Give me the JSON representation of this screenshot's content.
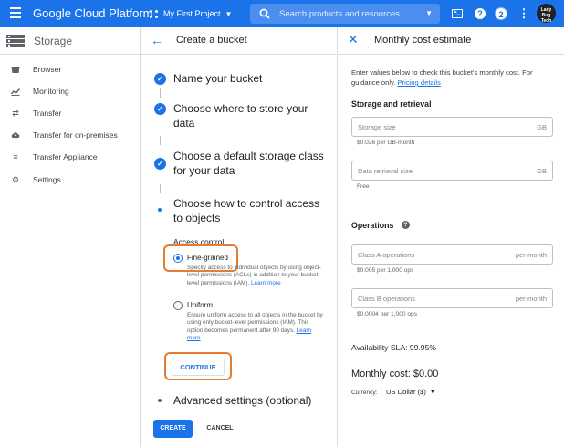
{
  "topbar": {
    "title": "Google Cloud Platform",
    "project": "My First Project",
    "search_placeholder": "Search products and resources",
    "notification_count": "2",
    "avatar_text": "Lady Bug Tech"
  },
  "leftnav": {
    "title": "Storage",
    "items": [
      {
        "label": "Browser",
        "icon": "bucket-icon"
      },
      {
        "label": "Monitoring",
        "icon": "monitoring-icon"
      },
      {
        "label": "Transfer",
        "icon": "transfer-icon"
      },
      {
        "label": "Transfer for on-premises",
        "icon": "cloud-upload-icon"
      },
      {
        "label": "Transfer Appliance",
        "icon": "appliance-icon"
      },
      {
        "label": "Settings",
        "icon": "gear-icon"
      }
    ]
  },
  "wizard": {
    "title": "Create a bucket",
    "steps": [
      {
        "label": "Name your bucket",
        "state": "done"
      },
      {
        "label": "Choose where to store your data",
        "state": "done"
      },
      {
        "label": "Choose a default storage class for your data",
        "state": "done"
      },
      {
        "label": "Choose how to control access to objects",
        "state": "current"
      },
      {
        "label": "Advanced settings (optional)",
        "state": "pending"
      }
    ],
    "access_control": {
      "label": "Access control",
      "options": [
        {
          "label": "Fine-grained",
          "selected": true,
          "description": "Specify access to individual objects by using object-level permissions (ACLs) in addition to your bucket-level permissions (IAM).",
          "link": "Learn more"
        },
        {
          "label": "Uniform",
          "selected": false,
          "description": "Ensure uniform access to all objects in the bucket by using only bucket-level permissions (IAM). This option becomes permanent after 90 days.",
          "link": "Learn more"
        }
      ]
    },
    "continue_label": "CONTINUE",
    "create_label": "CREATE",
    "cancel_label": "CANCEL"
  },
  "estimate": {
    "title": "Monthly cost estimate",
    "intro": "Enter values below to check this bucket's monthly cost. For guidance only.",
    "pricing_link": "Pricing details",
    "storage_section": "Storage and retrieval",
    "storage_size": {
      "placeholder": "Storage size",
      "unit": "GB",
      "hint": "$0.026 per GB-month"
    },
    "retrieval_size": {
      "placeholder": "Data retrieval size",
      "unit": "GB",
      "hint": "Free"
    },
    "operations_section": "Operations",
    "class_a": {
      "placeholder": "Class A operations",
      "unit": "per-month",
      "hint": "$0.005 per 1,000 ops"
    },
    "class_b": {
      "placeholder": "Class B operations",
      "unit": "per-month",
      "hint": "$0.0004 per 1,000 ops"
    },
    "sla": "Availability SLA: 99.95%",
    "monthly_cost": "Monthly cost: $0.00",
    "currency_label": "Currency:",
    "currency_value": "US Dollar ($)"
  },
  "colors": {
    "brand": "#1a73e8",
    "highlight": "#e67c30"
  }
}
